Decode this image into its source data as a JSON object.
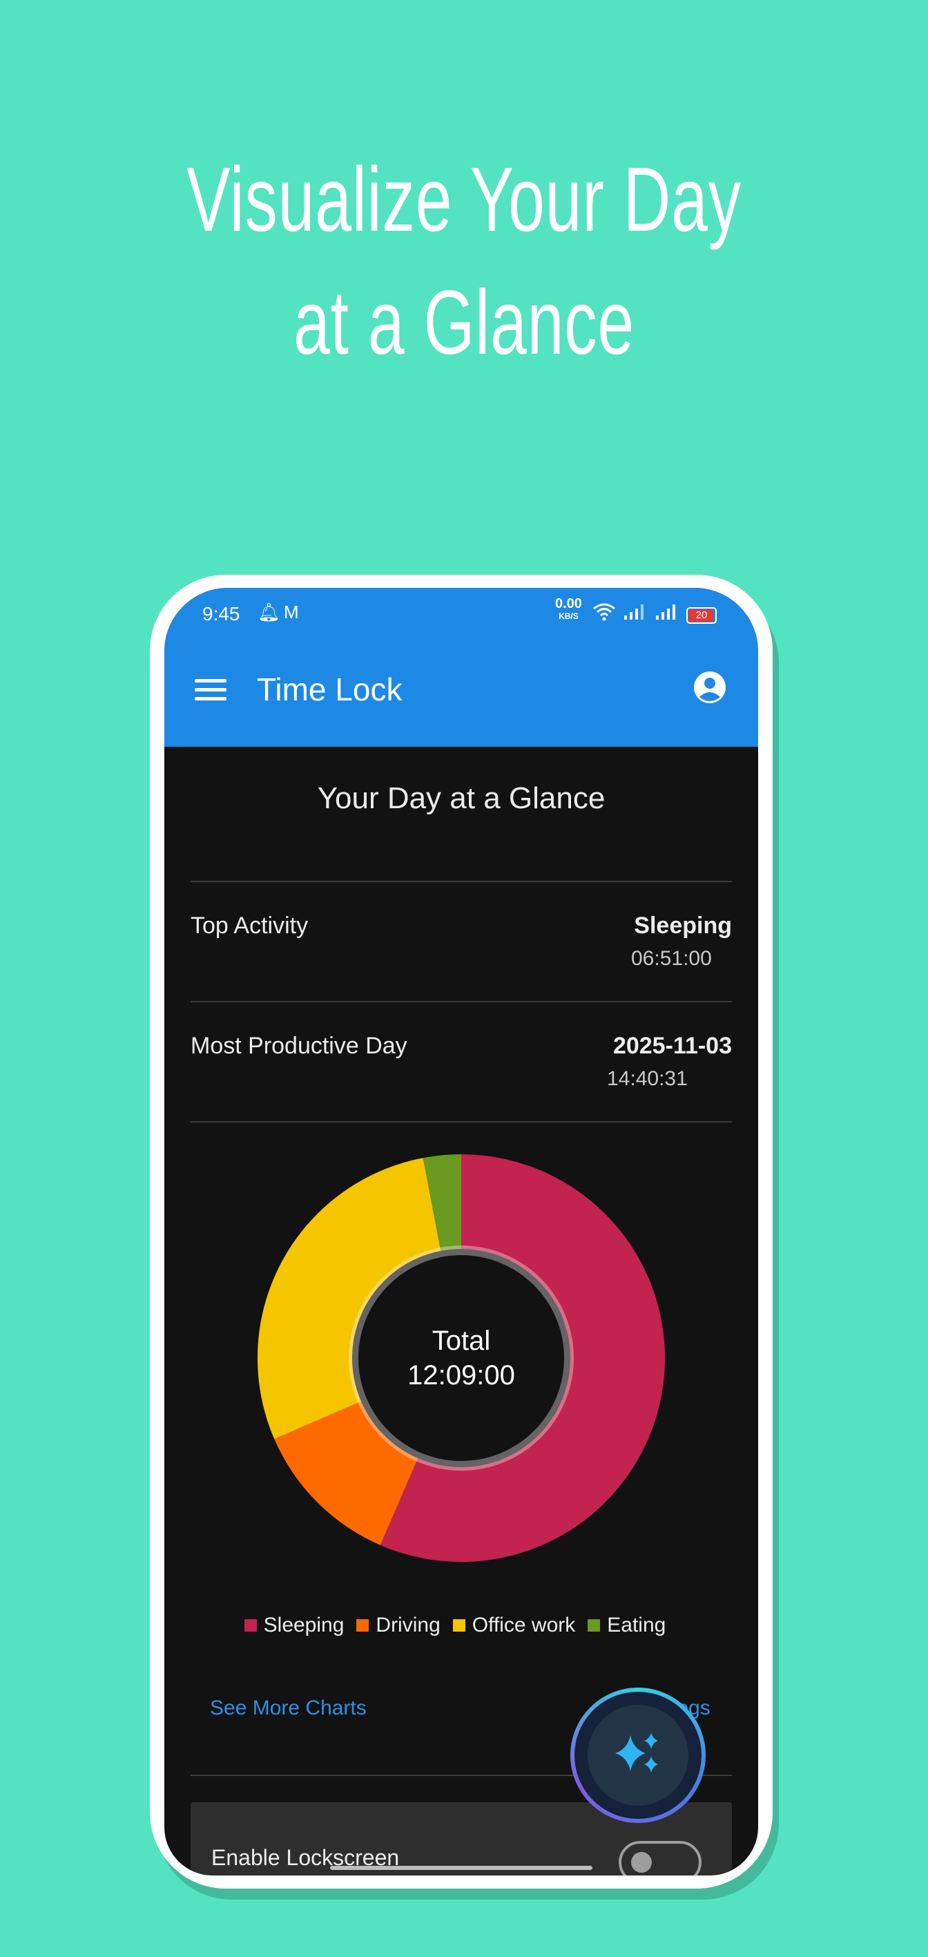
{
  "headline": {
    "line1": "Visualize Your Day",
    "line2": "at a Glance"
  },
  "status_bar": {
    "time": "9:45",
    "net_speed": "0.00",
    "net_unit": "KB/S",
    "battery": "20"
  },
  "app_bar": {
    "title": "Time Lock"
  },
  "glance": {
    "title": "Your Day at a Glance"
  },
  "top_activity": {
    "label": "Top Activity",
    "value": "Sleeping",
    "duration": "06:51:00"
  },
  "productive_day": {
    "label": "Most Productive Day",
    "value": "2025-11-03",
    "duration": "14:40:31"
  },
  "chart_data": {
    "type": "pie",
    "variant": "donut",
    "center_label": "Total",
    "center_value": "12:09:00",
    "slices": [
      {
        "name": "Sleeping",
        "fraction": 0.565,
        "color": "#C2244F"
      },
      {
        "name": "Driving",
        "fraction": 0.12,
        "color": "#FF6A00"
      },
      {
        "name": "Office work",
        "fraction": 0.285,
        "color": "#F5C500"
      },
      {
        "name": "Eating",
        "fraction": 0.03,
        "color": "#6A9A1F"
      }
    ]
  },
  "legend": {
    "items": [
      {
        "label": "Sleeping",
        "color": "#C2244F"
      },
      {
        "label": "Driving",
        "color": "#FF6A00"
      },
      {
        "label": "Office work",
        "color": "#F5C500"
      },
      {
        "label": "Eating",
        "color": "#6A9A1F"
      }
    ]
  },
  "links": {
    "see_more": "See More Charts",
    "see_logs": "See Logs"
  },
  "lockscreen": {
    "label": "Enable Lockscreen"
  },
  "colors": {
    "background": "#53E3C0",
    "app_bar": "#1E88E5",
    "screen": "#121212",
    "link": "#2F8FE6"
  }
}
